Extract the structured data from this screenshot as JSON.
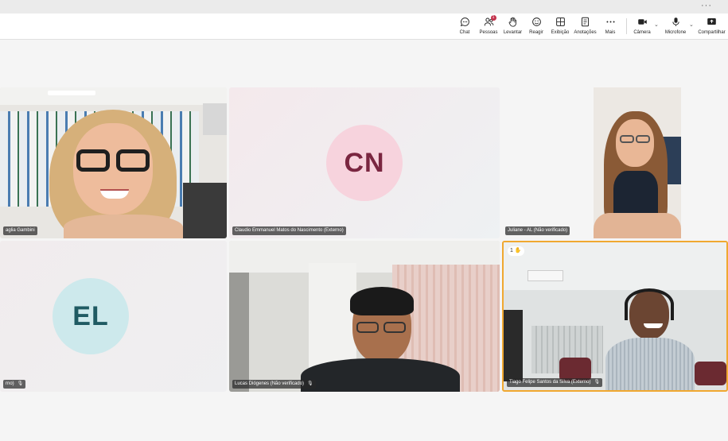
{
  "window": {
    "more_label": "···"
  },
  "toolbar": {
    "items": [
      {
        "label": "Chat",
        "icon": "chat-icon"
      },
      {
        "label": "Pessoas",
        "icon": "people-icon",
        "badge": "1"
      },
      {
        "label": "Levantar",
        "icon": "raise-hand-icon"
      },
      {
        "label": "Reagir",
        "icon": "react-icon"
      },
      {
        "label": "Exibição",
        "icon": "view-icon"
      },
      {
        "label": "Anotações",
        "icon": "notes-icon"
      },
      {
        "label": "Mais",
        "icon": "more-icon"
      },
      {
        "label": "Câmera",
        "icon": "camera-icon"
      },
      {
        "label": "Microfone",
        "icon": "microphone-icon"
      },
      {
        "label": "Compartilhar",
        "icon": "share-icon"
      }
    ]
  },
  "participants": [
    {
      "name": "aglia Gambini",
      "type": "video"
    },
    {
      "name": "Claudio Emmanuel Matos do Nascimento (Externo)",
      "initials": "CN",
      "type": "avatar",
      "avatar_bg": "#f7d3dd",
      "avatar_fg": "#7a2640"
    },
    {
      "name": "Juliane - AL (Não verificado)",
      "type": "video"
    },
    {
      "name": "rno)",
      "initials": "EL",
      "type": "avatar",
      "avatar_bg": "#cde9ec",
      "avatar_fg": "#1f5b63",
      "muted": true
    },
    {
      "name": "Lucas Diógenes (Não verificado)",
      "type": "video",
      "muted": true
    },
    {
      "name": "Tiago Felipe Santos da Silva (Externo)",
      "type": "video",
      "muted": true,
      "active_speaker": true,
      "reaction_count": "1"
    }
  ],
  "colors": {
    "active_border": "#f0a830",
    "toolbar_bg": "#ffffff",
    "stage_bg": "#f5f5f5"
  }
}
